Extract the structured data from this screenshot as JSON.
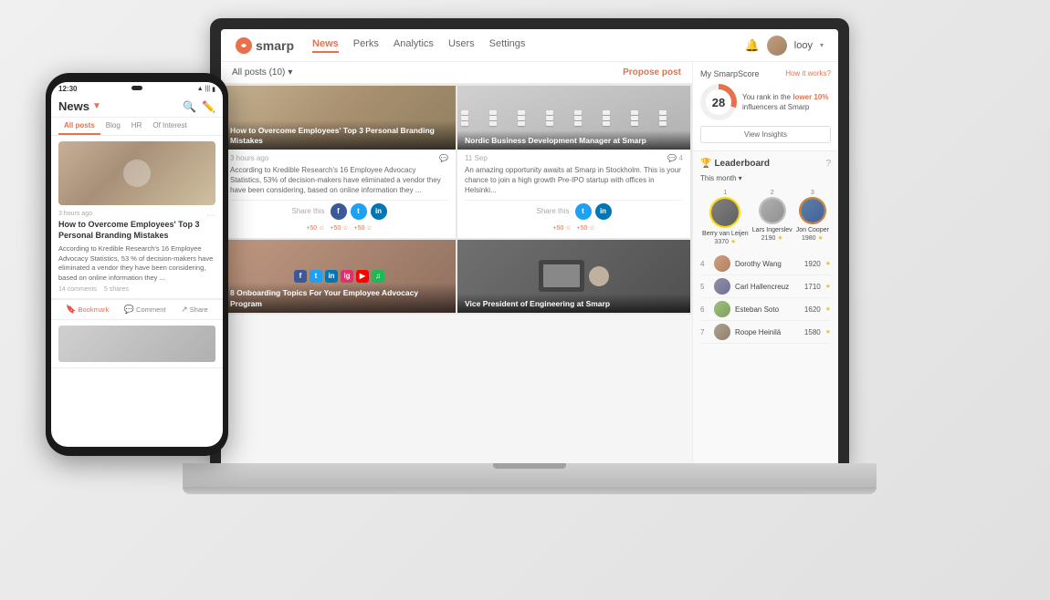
{
  "app": {
    "logo": "smarp",
    "nav": {
      "items": [
        {
          "label": "News",
          "active": true
        },
        {
          "label": "Perks",
          "active": false
        },
        {
          "label": "Analytics",
          "active": false
        },
        {
          "label": "Users",
          "active": false
        },
        {
          "label": "Settings",
          "active": false
        }
      ]
    },
    "header": {
      "username": "looy",
      "notification_icon": "🔔"
    }
  },
  "toolbar": {
    "all_posts": "All posts (10)",
    "filter_arrow": "▾",
    "propose": "Propose post"
  },
  "posts": [
    {
      "title": "How to Overcome Employees' Top 3 Personal Branding Mistakes",
      "timestamp": "3 hours ago",
      "comments": "",
      "text": "According to Kredible Research's 16 Employee Advocacy Statistics, 53% of decision-makers have eliminated a vendor they have been considering, based on online information they ...",
      "share_label": "Share this",
      "scores": [
        "+50",
        "+50",
        "+50"
      ]
    },
    {
      "title": "Nordic Business Development Manager at Smarp",
      "timestamp": "11 Sep",
      "comments": "4",
      "text": "An amazing opportunity awaits at Smarp in Stockholm. This is your chance to join a high growth Pre-IPO startup with offices in Helsinki...",
      "share_label": "Share this",
      "scores": [
        "+50",
        "+50"
      ]
    },
    {
      "title": "8 Onboarding Topics For Your Employee Advocacy Program",
      "timestamp": "",
      "comments": "",
      "text": "",
      "share_label": "",
      "scores": []
    },
    {
      "title": "Vice President of Engineering at Smarp",
      "timestamp": "",
      "comments": "",
      "text": "",
      "share_label": "",
      "scores": []
    }
  ],
  "smarp_score": {
    "section_title": "My SmarpScore",
    "how_it_works": "How it works?",
    "score": "28",
    "rank_text": "You rank in the",
    "rank_highlight": "lower 10%",
    "rank_suffix": "influencers at Smarp",
    "view_insights": "View Insights"
  },
  "leaderboard": {
    "title": "Leaderboard",
    "period": "This month",
    "period_arrow": "▾",
    "top_three": [
      {
        "rank": "1",
        "name": "Berry van Leijen",
        "score": "3370",
        "star": "★"
      },
      {
        "rank": "2",
        "name": "Lars Ingerslev",
        "score": "2190",
        "star": "★"
      },
      {
        "rank": "3",
        "name": "Jon Cooper",
        "score": "1980",
        "star": "★"
      }
    ],
    "list": [
      {
        "rank": "4",
        "name": "Dorothy Wang",
        "score": "1920",
        "star": "★"
      },
      {
        "rank": "5",
        "name": "Carl Hallencreuz",
        "score": "1710",
        "star": "★"
      },
      {
        "rank": "6",
        "name": "Esteban Soto",
        "score": "1620",
        "star": "★"
      },
      {
        "rank": "7",
        "name": "Roope Heinilä",
        "score": "1580",
        "star": "★"
      }
    ]
  },
  "phone": {
    "time": "12:30",
    "news_title": "News",
    "tabs": [
      "All posts",
      "Blog",
      "HR",
      "Of Interest"
    ],
    "post": {
      "timestamp": "3 hours ago",
      "title": "How to Overcome Employees' Top 3 Personal Branding Mistakes",
      "text": "According to Kredible Research's 16 Employee Advocacy Statistics, 53 % of decision-makers have eliminated a vendor they have been considering, based on online information they ...",
      "comments": "14 comments",
      "shares": "5 shares"
    },
    "actions": {
      "bookmark": "Bookmark",
      "comment": "Comment",
      "share": "Share"
    }
  }
}
